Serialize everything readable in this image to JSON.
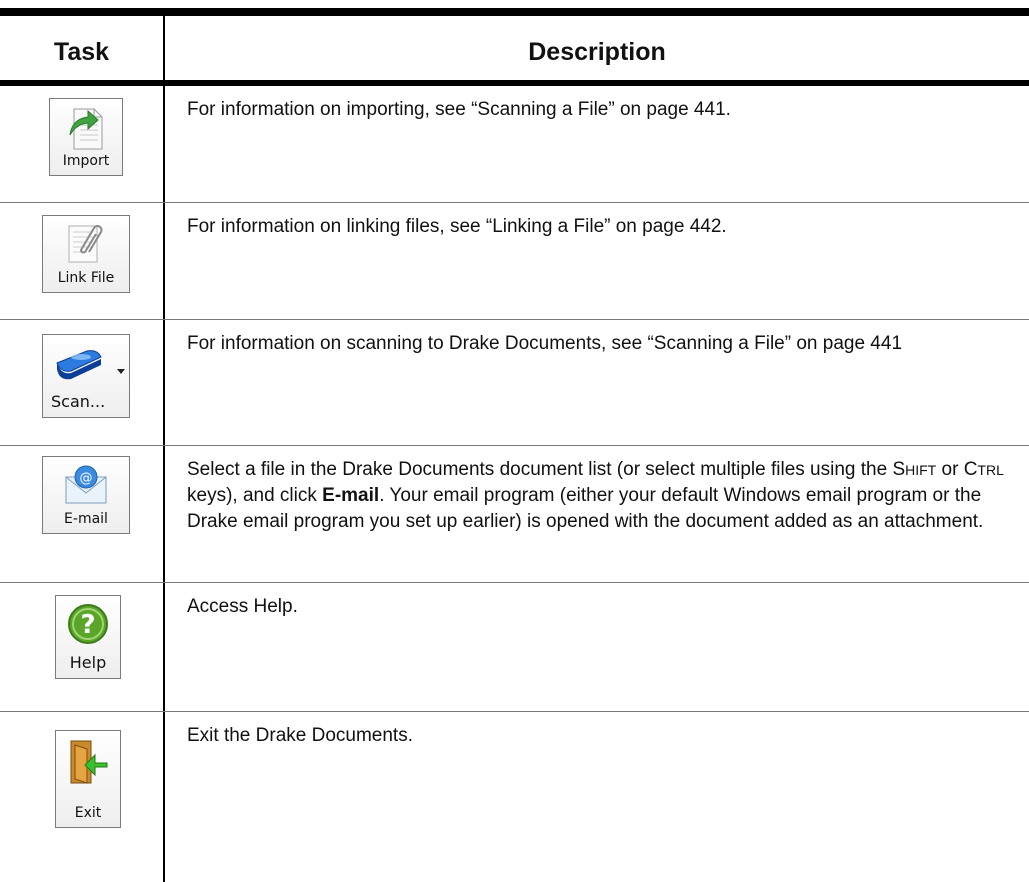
{
  "header": {
    "task": "Task",
    "description": "Description"
  },
  "rows": [
    {
      "button_label": "Import",
      "icon": "import-icon",
      "description": "For information on importing, see “Scanning a File” on page 441."
    },
    {
      "button_label": "Link File",
      "icon": "paperclip-document-icon",
      "description": "For information on linking files, see “Linking a File” on page 442."
    },
    {
      "button_label": "Scan...",
      "icon": "scanner-icon",
      "dropdown_icon": "dropdown-arrow-icon",
      "description": "For information on scanning to Drake Documents, see “Scanning a File” on page 441"
    },
    {
      "button_label": "E-mail",
      "icon": "email-envelope-icon",
      "description_parts": {
        "p1": "Select a file in the Drake Documents document list (or select multiple files using the ",
        "shift_first": "S",
        "shift_rest": "HIFT",
        "p2": " or ",
        "ctrl_first": "C",
        "ctrl_rest": "TRL",
        "p3": " keys), and click ",
        "bold": "E-mail",
        "p4": ". Your email program (either your default Windows email program or the Drake email program you set up earlier) is opened with the document added as an attachment."
      }
    },
    {
      "button_label": "Help",
      "icon": "help-question-icon",
      "description": "Access Help."
    },
    {
      "button_label": "Exit",
      "icon": "exit-door-icon",
      "description": "Exit the Drake Documents."
    }
  ],
  "colors": {
    "rule": "#000000",
    "help_green": "#5aa62a",
    "scanner_blue": "#1a5fd0",
    "exit_arrow": "#3cbf2f",
    "import_arrow": "#3fa33f"
  }
}
